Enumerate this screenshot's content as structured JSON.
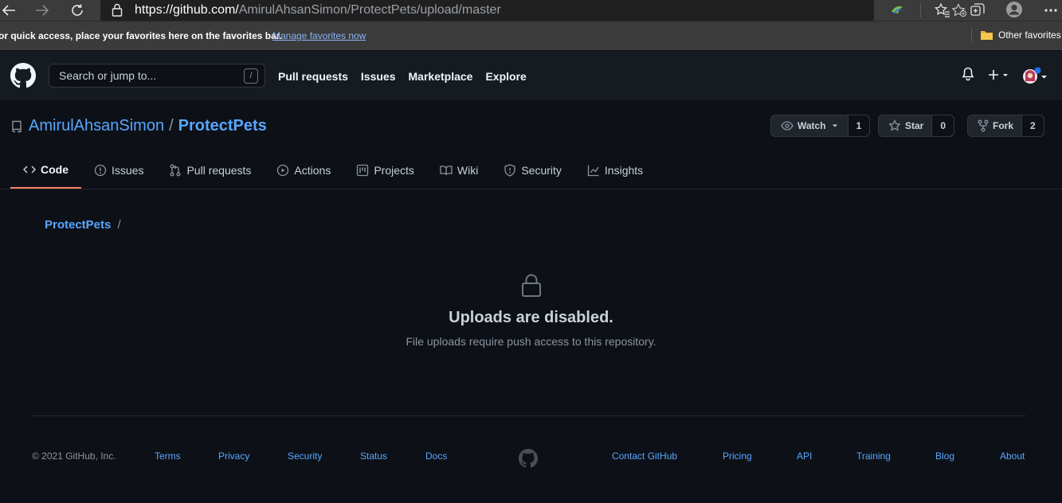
{
  "browser": {
    "url_host": "https://github.com/",
    "url_path": "AmirulAhsanSimon/ProtectPets/upload/master",
    "favorites_message": "or quick access, place your favorites here on the favorites bar.",
    "manage_favorites": "Manage favorites now",
    "other_favorites": "Other favorites"
  },
  "header": {
    "search_placeholder": "Search or jump to...",
    "search_key": "/",
    "nav": [
      "Pull requests",
      "Issues",
      "Marketplace",
      "Explore"
    ]
  },
  "repo": {
    "owner": "AmirulAhsanSimon",
    "separator": "/",
    "name": "ProtectPets",
    "watch_label": "Watch",
    "watch_count": "1",
    "star_label": "Star",
    "star_count": "0",
    "fork_label": "Fork",
    "fork_count": "2",
    "tabs": [
      "Code",
      "Issues",
      "Pull requests",
      "Actions",
      "Projects",
      "Wiki",
      "Security",
      "Insights"
    ]
  },
  "main": {
    "breadcrumb": "ProtectPets",
    "breadcrumb_sep": "/",
    "title": "Uploads are disabled.",
    "description": "File uploads require push access to this repository."
  },
  "footer": {
    "copyright": "© 2021 GitHub, Inc.",
    "links": [
      "Terms",
      "Privacy",
      "Security",
      "Status",
      "Docs",
      "Contact GitHub",
      "Pricing",
      "API",
      "Training",
      "Blog",
      "About"
    ]
  },
  "colors": {
    "accent_link": "#58a6ff",
    "active_tab": "#f78166",
    "background": "#0d1117"
  }
}
